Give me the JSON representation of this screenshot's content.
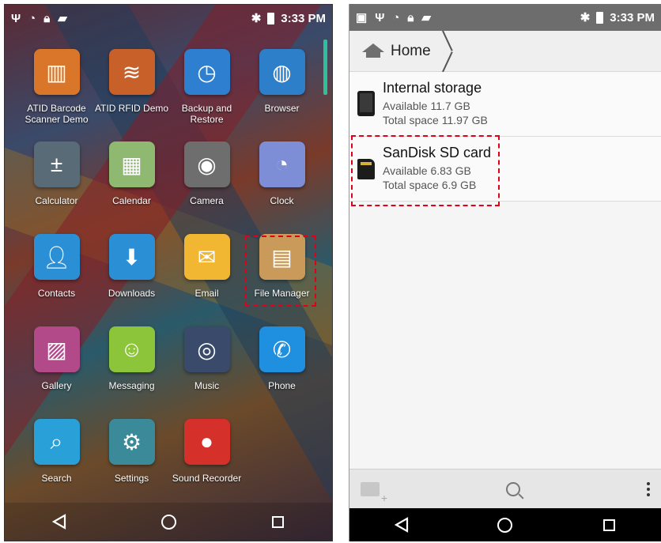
{
  "left": {
    "status": {
      "time": "3:33 PM"
    },
    "apps": [
      {
        "label": "ATID Barcode\nScanner Demo",
        "icon": "barcode-icon",
        "color": "#d9762a"
      },
      {
        "label": "ATID RFID Demo",
        "icon": "rfid-icon",
        "color": "#c8602a"
      },
      {
        "label": "Backup and\nRestore",
        "icon": "backup-clock-icon",
        "color": "#2f7fd1"
      },
      {
        "label": "Browser",
        "icon": "globe-icon",
        "color": "#2c7fc8"
      },
      {
        "label": "Calculator",
        "icon": "calculator-icon",
        "color": "#5a6b78"
      },
      {
        "label": "Calendar",
        "icon": "calendar-icon",
        "color": "#8fb870"
      },
      {
        "label": "Camera",
        "icon": "camera-icon",
        "color": "#6e6e6e"
      },
      {
        "label": "Clock",
        "icon": "clock-icon",
        "color": "#7d8dd6"
      },
      {
        "label": "Contacts",
        "icon": "contacts-icon",
        "color": "#2b8fd6"
      },
      {
        "label": "Downloads",
        "icon": "download-icon",
        "color": "#2b8fd6"
      },
      {
        "label": "Email",
        "icon": "email-icon",
        "color": "#f2b732"
      },
      {
        "label": "File Manager",
        "icon": "file-manager-icon",
        "color": "#c99a5a"
      },
      {
        "label": "Gallery",
        "icon": "gallery-icon",
        "color": "#b24a8a"
      },
      {
        "label": "Messaging",
        "icon": "messaging-icon",
        "color": "#8cc43a"
      },
      {
        "label": "Music",
        "icon": "music-icon",
        "color": "#3a4a6a"
      },
      {
        "label": "Phone",
        "icon": "phone-icon",
        "color": "#1f8fe0"
      },
      {
        "label": "Search",
        "icon": "search-icon",
        "color": "#2aa0d8"
      },
      {
        "label": "Settings",
        "icon": "settings-gear-icon",
        "color": "#3a8a9a"
      },
      {
        "label": "Sound Recorder",
        "icon": "microphone-icon",
        "color": "#d6302a"
      }
    ]
  },
  "right": {
    "status": {
      "time": "3:33 PM"
    },
    "breadcrumb": {
      "label": "Home"
    },
    "storage": [
      {
        "name": "Internal storage",
        "available": "Available 11.7 GB",
        "total": "Total space 11.97 GB",
        "kind": "phone"
      },
      {
        "name": "SanDisk SD card",
        "available": "Available 6.83 GB",
        "total": "Total space 6.9 GB",
        "kind": "sd"
      }
    ]
  }
}
